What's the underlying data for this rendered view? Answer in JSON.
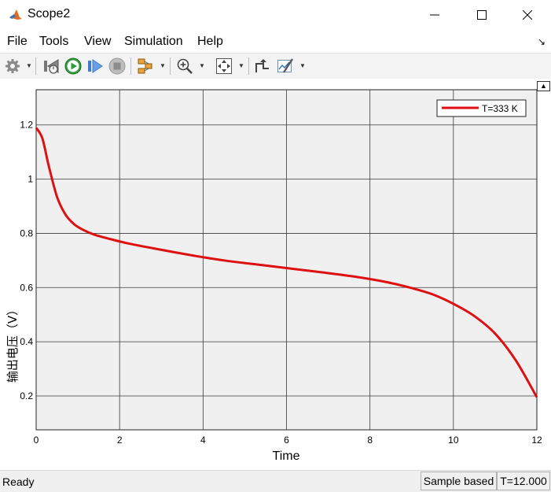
{
  "window": {
    "title": "Scope2"
  },
  "menu": {
    "items": [
      "File",
      "Tools",
      "View",
      "Simulation",
      "Help"
    ]
  },
  "toolbar": {
    "icons": [
      "settings-icon",
      "step-back-icon",
      "run-icon",
      "step-forward-icon",
      "stop-icon",
      "highlight-block-icon",
      "zoom-in-icon",
      "fit-to-view-icon",
      "scale-axes-icon",
      "style-icon"
    ]
  },
  "status": {
    "left": "Ready",
    "mode": "Sample based",
    "time": "T=12.000"
  },
  "colors": {
    "line": "#dd1111",
    "axes_bg": "#f0f0f0",
    "grid": "#3a3a3a"
  },
  "chart_data": {
    "type": "line",
    "title": "",
    "xlabel": "Time",
    "ylabel": "输出电压（V）",
    "xlim": [
      0,
      12
    ],
    "ylim": [
      0.075,
      1.33
    ],
    "xticks": [
      0,
      2,
      4,
      6,
      8,
      10,
      12
    ],
    "yticks": [
      0.2,
      0.4,
      0.6,
      0.8,
      1,
      1.2
    ],
    "grid": true,
    "legend_position": "top-right",
    "series": [
      {
        "name": "T=333 K",
        "color": "#dd1111",
        "x": [
          0,
          0.15,
          0.3,
          0.5,
          0.7,
          0.9,
          1.1,
          1.4,
          1.8,
          2.2,
          2.8,
          3.4,
          4.0,
          4.6,
          5.2,
          6.0,
          6.8,
          7.6,
          8.4,
          9.0,
          9.5,
          10.0,
          10.5,
          11.0,
          11.5,
          12.0
        ],
        "y": [
          1.19,
          1.15,
          1.05,
          0.935,
          0.87,
          0.835,
          0.815,
          0.795,
          0.778,
          0.763,
          0.745,
          0.728,
          0.712,
          0.698,
          0.687,
          0.672,
          0.657,
          0.641,
          0.62,
          0.598,
          0.575,
          0.54,
          0.495,
          0.43,
          0.33,
          0.195
        ]
      }
    ]
  }
}
